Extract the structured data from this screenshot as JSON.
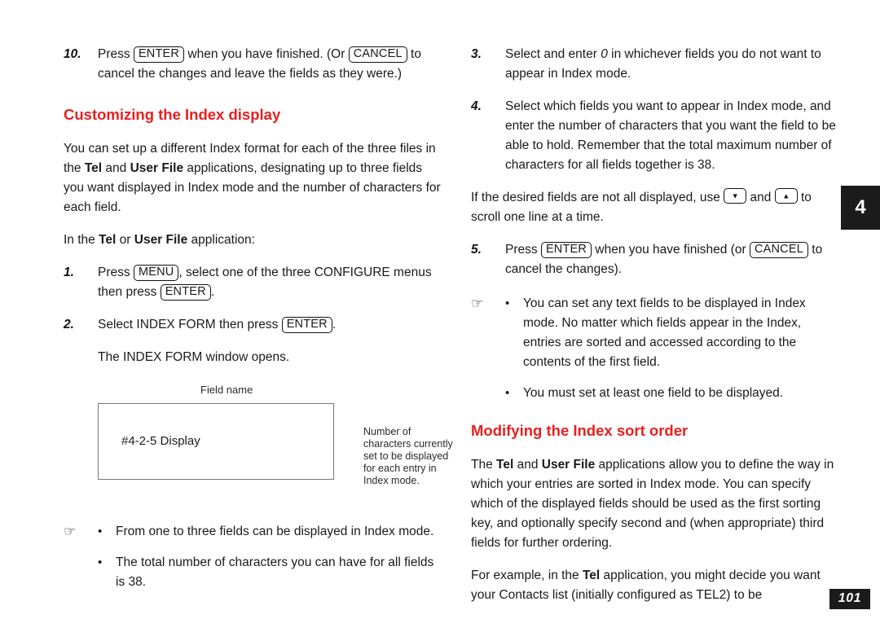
{
  "page": {
    "number": "101",
    "chapter_tab": "4"
  },
  "left_column": {
    "step10": {
      "num": "10.",
      "text_a": "Press ",
      "key_enter": "ENTER",
      "text_b": " when you have finished. (Or ",
      "key_cancel": "CANCEL",
      "text_c": " to cancel the changes and leave the fields as they were.)"
    },
    "heading": "Customizing the Index display",
    "intro": {
      "a": "You can set up a different Index format for each of the three files in the ",
      "bold1": "Tel",
      "b": " and ",
      "bold2": "User File",
      "c": " applications, designating up to three fields you want displayed in Index mode and the number of characters for each field."
    },
    "application_line": {
      "a": "In the ",
      "bold1": "Tel",
      "b": " or ",
      "bold2": "User File",
      "c": " application:"
    },
    "step1": {
      "num": "1.",
      "text_a": "Press ",
      "key_menu": "MENU",
      "text_b": ", select one of the three CONFIGURE menus then press ",
      "key_enter": "ENTER",
      "text_c": "."
    },
    "step2": {
      "num": "2.",
      "text_a": "Select INDEX FORM then press ",
      "key_enter": "ENTER",
      "text_b": "."
    },
    "step2_note": "The INDEX FORM window opens.",
    "figure": {
      "field_name_label": "Field name",
      "screen_text": "#4-2-5 Display",
      "char_note": "Number of characters currently set to be displayed for each entry in Index mode."
    },
    "notes": {
      "hand_icon": "pointing-hand-icon",
      "items": [
        "From one to three fields can be displayed in Index mode.",
        "The total number of characters you can have for all fields is 38."
      ]
    }
  },
  "right_column": {
    "step3": {
      "num": "3.",
      "text_a": "Select and enter ",
      "italic_zero": "0",
      "text_b": " in whichever fields you do not want to appear in Index mode."
    },
    "step4": {
      "num": "4.",
      "text": "Select which fields you want to appear in Index mode, and enter the number of characters that you want the field to be able to hold. Remember that the total maximum number of characters for all fields together is 38."
    },
    "scroll_para": {
      "a": "If the desired fields are not all displayed, use ",
      "key_down": "scroll-down-key-icon",
      "b": " and ",
      "key_up": "scroll-up-key-icon",
      "c": " to scroll one line at a time."
    },
    "step5": {
      "num": "5.",
      "text_a": "Press ",
      "key_enter": "ENTER",
      "text_b": " when you have finished (or ",
      "key_cancel": "CANCEL",
      "text_c": " to cancel the changes)."
    },
    "notes": {
      "hand_icon": "pointing-hand-icon",
      "items": [
        "You can set any text fields to be displayed in Index mode. No matter which fields appear in the Index, entries are sorted and accessed according to the contents of the first field.",
        "You must set at least one field to be displayed."
      ]
    },
    "heading": "Modifying the Index sort order",
    "sort_para": {
      "a": "The ",
      "bold1": "Tel",
      "b": " and ",
      "bold2": "User File",
      "c": " applications allow you to define the way in which your entries are sorted in Index mode. You can specify which of the displayed fields should be used as the first sorting key, and optionally specify second and (when appropriate) third fields for further ordering."
    },
    "example_para": {
      "a": "For example, in the ",
      "bold1": "Tel",
      "b": " application, you might decide you want your Contacts list (initially configured as TEL2) to be"
    }
  },
  "colors": {
    "heading_red": "#e8201f",
    "tab_black": "#1b1b1b",
    "box_border": "#777777"
  }
}
